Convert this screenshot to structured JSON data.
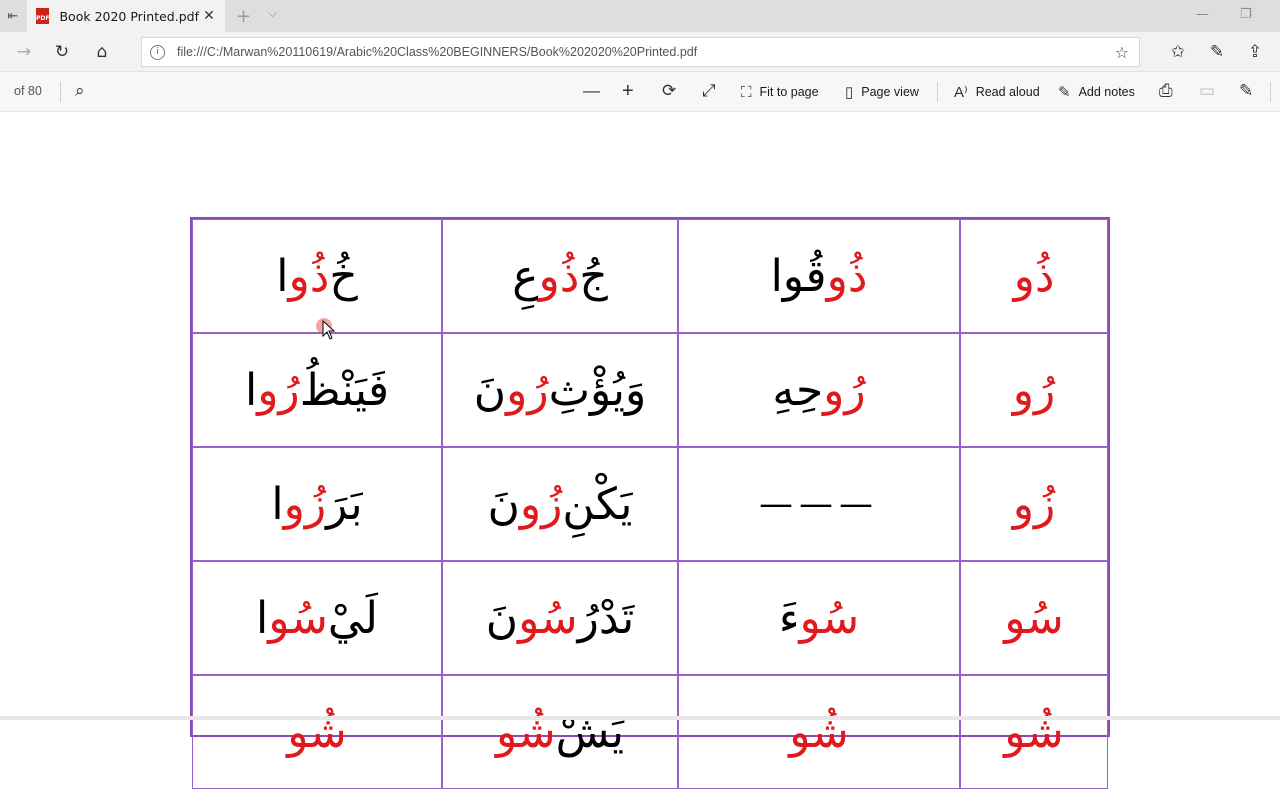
{
  "tab": {
    "title": "Book 2020 Printed.pdf",
    "close": "✕",
    "new": "+",
    "menu": "⌵",
    "pdf_badge": "PDF"
  },
  "window": {
    "minimize": "—",
    "restore": "❐"
  },
  "nav": {
    "back": "←",
    "forward": "→",
    "refresh": "↻",
    "home": "⌂",
    "info": "i",
    "url": "file:///C:/Marwan%20110619/Arabic%20Class%20BEGINNERS/Book%202020%20Printed.pdf",
    "favorite": "☆",
    "favorites_hub": "✩",
    "notes": "✎",
    "share": "⇪"
  },
  "pdf_toolbar": {
    "page_of": "of 80",
    "search_icon": "⌕",
    "zoom_out": "—",
    "zoom_in": "+",
    "rotate": "⟳",
    "fullscreen": "⤢",
    "fit_to_page": "Fit to page",
    "page_view": "Page view",
    "read_aloud": "Read aloud",
    "add_notes": "Add notes",
    "print": "⎙",
    "save": "▭",
    "save_as": "✎"
  },
  "table": {
    "rows": [
      [
        {
          "pre": "",
          "red": "ذُو",
          "post": ""
        },
        {
          "pre": "",
          "red": "ذُو",
          "post": "قُوا"
        },
        {
          "pre": "جُ",
          "red": "ذُو",
          "post": "عِ"
        },
        {
          "pre": "خُ",
          "red": "ذُو",
          "post": "ا"
        }
      ],
      [
        {
          "pre": "",
          "red": "رُو",
          "post": ""
        },
        {
          "pre": "",
          "red": "رُو",
          "post": "حِهِ"
        },
        {
          "pre": "وَيُؤْثِ",
          "red": "رُو",
          "post": "نَ"
        },
        {
          "pre": "فَيَنْظُ",
          "red": "رُو",
          "post": "ا"
        }
      ],
      [
        {
          "pre": "",
          "red": "زُو",
          "post": ""
        },
        {
          "pre": "",
          "red": "",
          "post": "",
          "dash": "———"
        },
        {
          "pre": "يَكْنِ",
          "red": "زُو",
          "post": "نَ"
        },
        {
          "pre": "بَرَ",
          "red": "زُو",
          "post": "ا"
        }
      ],
      [
        {
          "pre": "",
          "red": "سُو",
          "post": ""
        },
        {
          "pre": "",
          "red": "سُو",
          "post": "ءَ"
        },
        {
          "pre": "تَدْرُ",
          "red": "سُو",
          "post": "نَ"
        },
        {
          "pre": "لَيْ",
          "red": "سُو",
          "post": "ا"
        }
      ],
      [
        {
          "pre": "",
          "red": "شُو",
          "post": ""
        },
        {
          "pre": "",
          "red": "شُو",
          "post": ""
        },
        {
          "pre": "يَشْ",
          "red": "شُو",
          "post": ""
        },
        {
          "pre": "",
          "red": "شُو",
          "post": ""
        }
      ]
    ]
  }
}
